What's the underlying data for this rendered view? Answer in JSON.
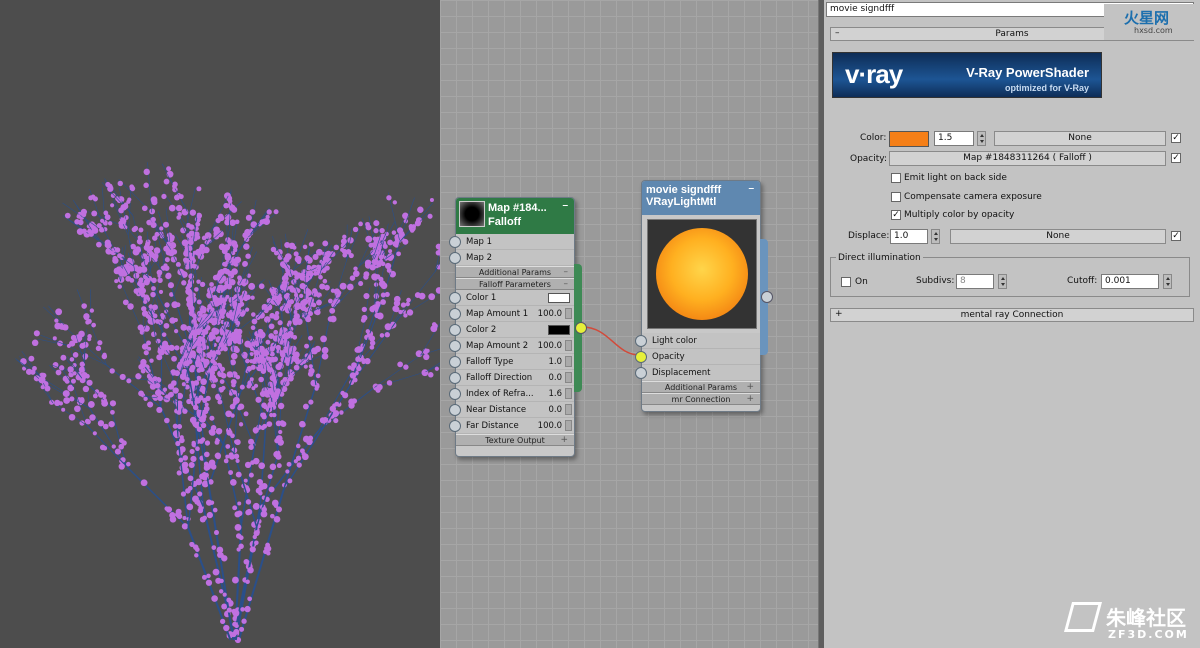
{
  "node_map": {
    "title_line1": "Map #184...",
    "title_line2": "Falloff",
    "rows_top": [
      "Map 1",
      "Map 2"
    ],
    "rollout_additional": "Additional Params",
    "rollout_falloff": "Falloff Parameters",
    "params": [
      {
        "label": "Color 1",
        "value": "",
        "swatch": "#ffffff"
      },
      {
        "label": "Map Amount 1",
        "value": "100.0"
      },
      {
        "label": "Color 2",
        "value": "",
        "swatch": "#000000"
      },
      {
        "label": "Map Amount 2",
        "value": "100.0"
      },
      {
        "label": "Falloff Type",
        "value": "1.0"
      },
      {
        "label": "Falloff Direction",
        "value": "0.0"
      },
      {
        "label": "Index of Refra...",
        "value": "1.6"
      },
      {
        "label": "Near Distance",
        "value": "0.0"
      },
      {
        "label": "Far Distance",
        "value": "100.0"
      }
    ],
    "rollout_texture": "Texture Output"
  },
  "node_light": {
    "title_line1": "movie signdfff",
    "title_line2": "VRayLightMtl",
    "inputs": [
      "Light color",
      "Opacity",
      "Displacement"
    ],
    "rollout_additional": "Additional Params",
    "rollout_mr": "mr Connection"
  },
  "panel": {
    "name_field": "movie signdfff",
    "params_rollout": "Params",
    "banner_logo": "v·ray",
    "banner_title": "V-Ray PowerShader",
    "banner_subtitle": "optimized for V-Ray",
    "color_label": "Color:",
    "color_swatch": "#f57f17",
    "color_value": "1.5",
    "color_map": "None",
    "opacity_label": "Opacity:",
    "opacity_map": "Map #1848311264  ( Falloff )",
    "check_emit": "Emit light on back side",
    "check_compensate": "Compensate camera exposure",
    "check_multiply": "Multiply color by opacity",
    "multiply_checked": "✓",
    "displace_label": "Displace:",
    "displace_value": "1.0",
    "displace_map": "None",
    "direct_group": "Direct illumination",
    "on_label": "On",
    "subdivs_label": "Subdivs:",
    "subdivs_value": "8",
    "cutoff_label": "Cutoff:",
    "cutoff_value": "0.001",
    "mr_rollout": "mental ray Connection",
    "mr_plus": "+",
    "params_minus": "–"
  },
  "watermarks": {
    "top_right": "火星网",
    "top_right_sub": "hxsd.com",
    "bottom_right": "朱峰社区",
    "bottom_right_sub": "ZF3D.COM"
  },
  "colors": {
    "map_header": "#2f7a45",
    "light_header": "#5f88b0",
    "wire": "#d24a3a",
    "socket_active": "#e6f03a",
    "flowers": "#c070e0",
    "branches": "#2a4f8a"
  }
}
